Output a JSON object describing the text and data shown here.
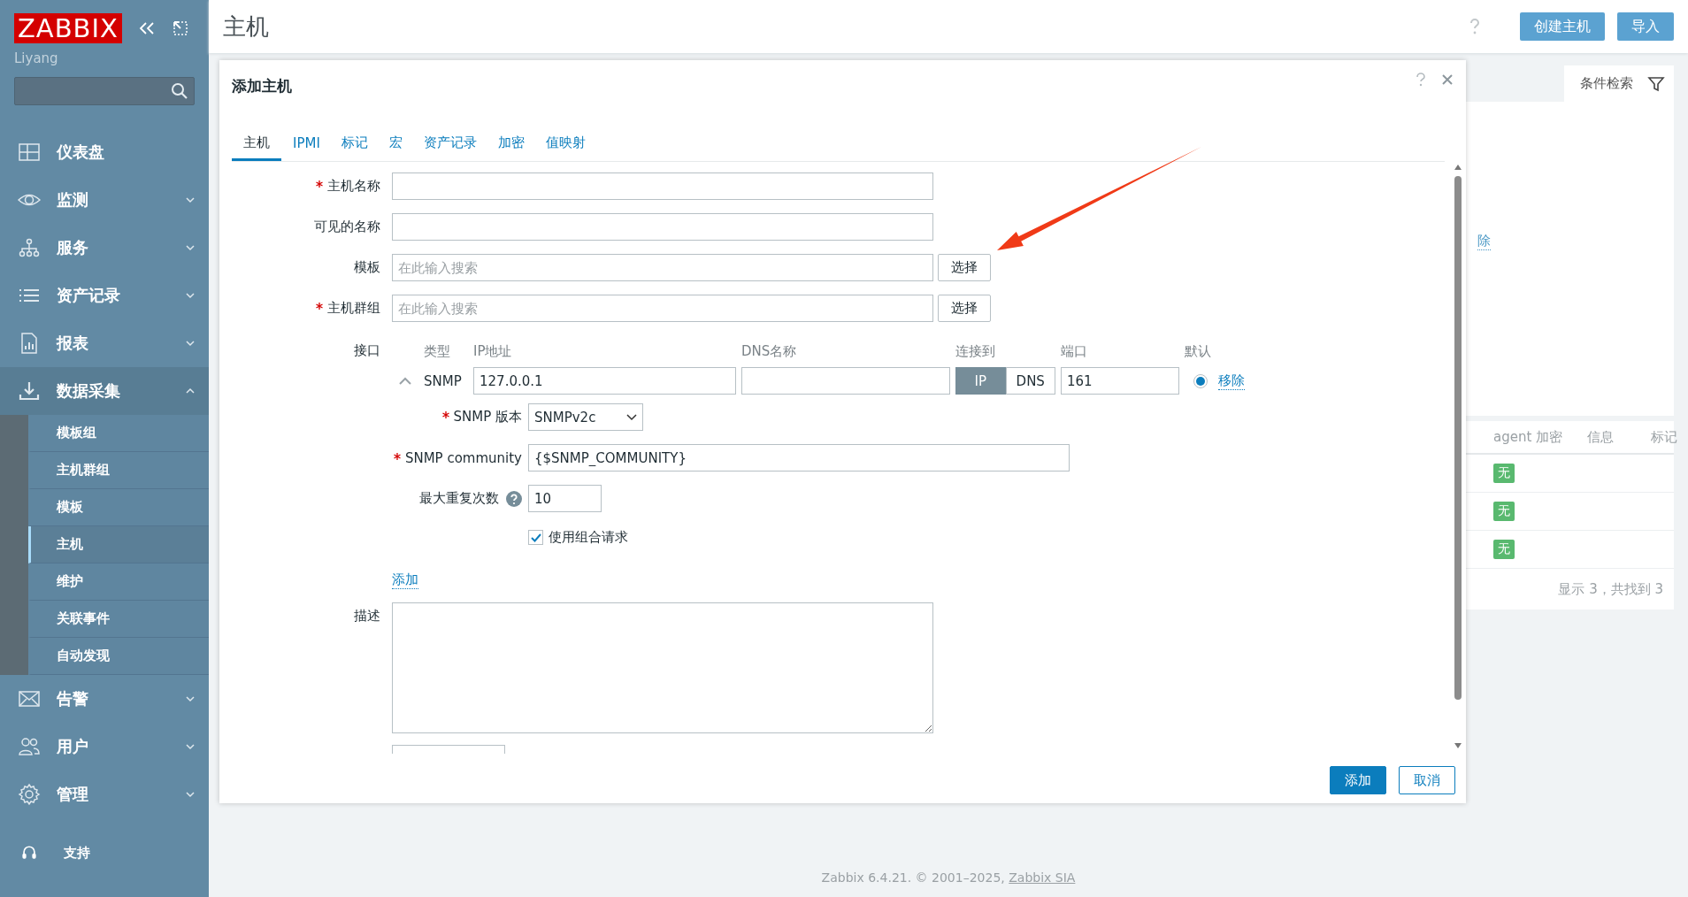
{
  "sidebar": {
    "logo": "ZABBIX",
    "user": "Liyang",
    "menu": [
      {
        "label": "仪表盘"
      },
      {
        "label": "监测",
        "expanded": false
      },
      {
        "label": "服务",
        "expanded": false
      },
      {
        "label": "资产记录",
        "expanded": false
      },
      {
        "label": "报表",
        "expanded": false
      },
      {
        "label": "数据采集",
        "expanded": true,
        "children": [
          {
            "label": "模板组",
            "selected": false
          },
          {
            "label": "主机群组",
            "selected": false
          },
          {
            "label": "模板",
            "selected": false
          },
          {
            "label": "主机",
            "selected": true
          },
          {
            "label": "维护",
            "selected": false
          },
          {
            "label": "关联事件",
            "selected": false
          },
          {
            "label": "自动发现",
            "selected": false
          }
        ]
      },
      {
        "label": "告警",
        "expanded": false
      },
      {
        "label": "用户",
        "expanded": false
      },
      {
        "label": "管理",
        "expanded": false
      }
    ],
    "bottom": [
      {
        "label": "支持"
      }
    ]
  },
  "page": {
    "title": "主机",
    "header_buttons": [
      "创建主机",
      "导入"
    ],
    "filter_tab": "条件检索",
    "filter_link_partial": "除",
    "table": {
      "columns": [
        "agent 加密",
        "信息",
        "标记"
      ],
      "rows": [
        {
          "agent_encryption": "无"
        },
        {
          "agent_encryption": "无"
        },
        {
          "agent_encryption": "无"
        }
      ],
      "summary": "显示 3，共找到 3"
    }
  },
  "footer": {
    "text": "Zabbix 6.4.21. © 2001–2025, ",
    "link": "Zabbix SIA"
  },
  "dialog": {
    "title": "添加主机",
    "tabs": [
      {
        "label": "主机",
        "selected": true
      },
      {
        "label": "IPMI",
        "selected": false
      },
      {
        "label": "标记",
        "selected": false
      },
      {
        "label": "宏",
        "selected": false
      },
      {
        "label": "资产记录",
        "selected": false
      },
      {
        "label": "加密",
        "selected": false
      },
      {
        "label": "值映射",
        "selected": false
      }
    ],
    "fields": [
      {
        "label": "主机名称",
        "required": true,
        "kind": "text"
      },
      {
        "label": "可见的名称",
        "required": false,
        "kind": "text"
      },
      {
        "label": "模板",
        "required": false,
        "kind": "multiselect",
        "placeholder": "在此输入搜索",
        "button": "选择"
      },
      {
        "label": "主机群组",
        "required": true,
        "kind": "multiselect",
        "placeholder": "在此输入搜索",
        "button": "选择"
      }
    ],
    "interfaces": {
      "label": "接口",
      "columns": [
        "类型",
        "IP地址",
        "DNS名称",
        "连接到",
        "端口",
        "默认"
      ],
      "rows": [
        {
          "expanded": true,
          "type": "SNMP",
          "ip": "127.0.0.1",
          "connect": [
            {
              "label": "IP",
              "selected": true
            },
            {
              "label": "DNS",
              "selected": false
            }
          ],
          "port": "161",
          "default": true,
          "remove": "移除",
          "snmp": {
            "version_label": "SNMP 版本",
            "version": "SNMPv2c",
            "community_label": "SNMP community",
            "community": "{$SNMP_COMMUNITY}",
            "max_label": "最大重复次数",
            "max": "10",
            "bulk_label": "使用组合请求",
            "bulk": true
          }
        }
      ],
      "add_link": "添加"
    },
    "description": {
      "label": "描述"
    },
    "fields_below": [
      {
        "kind": "text"
      }
    ],
    "buttons": [
      {
        "label": "添加",
        "primary": true
      },
      {
        "label": "取消",
        "primary": false
      }
    ]
  },
  "annotation": {
    "kind": "arrow"
  }
}
